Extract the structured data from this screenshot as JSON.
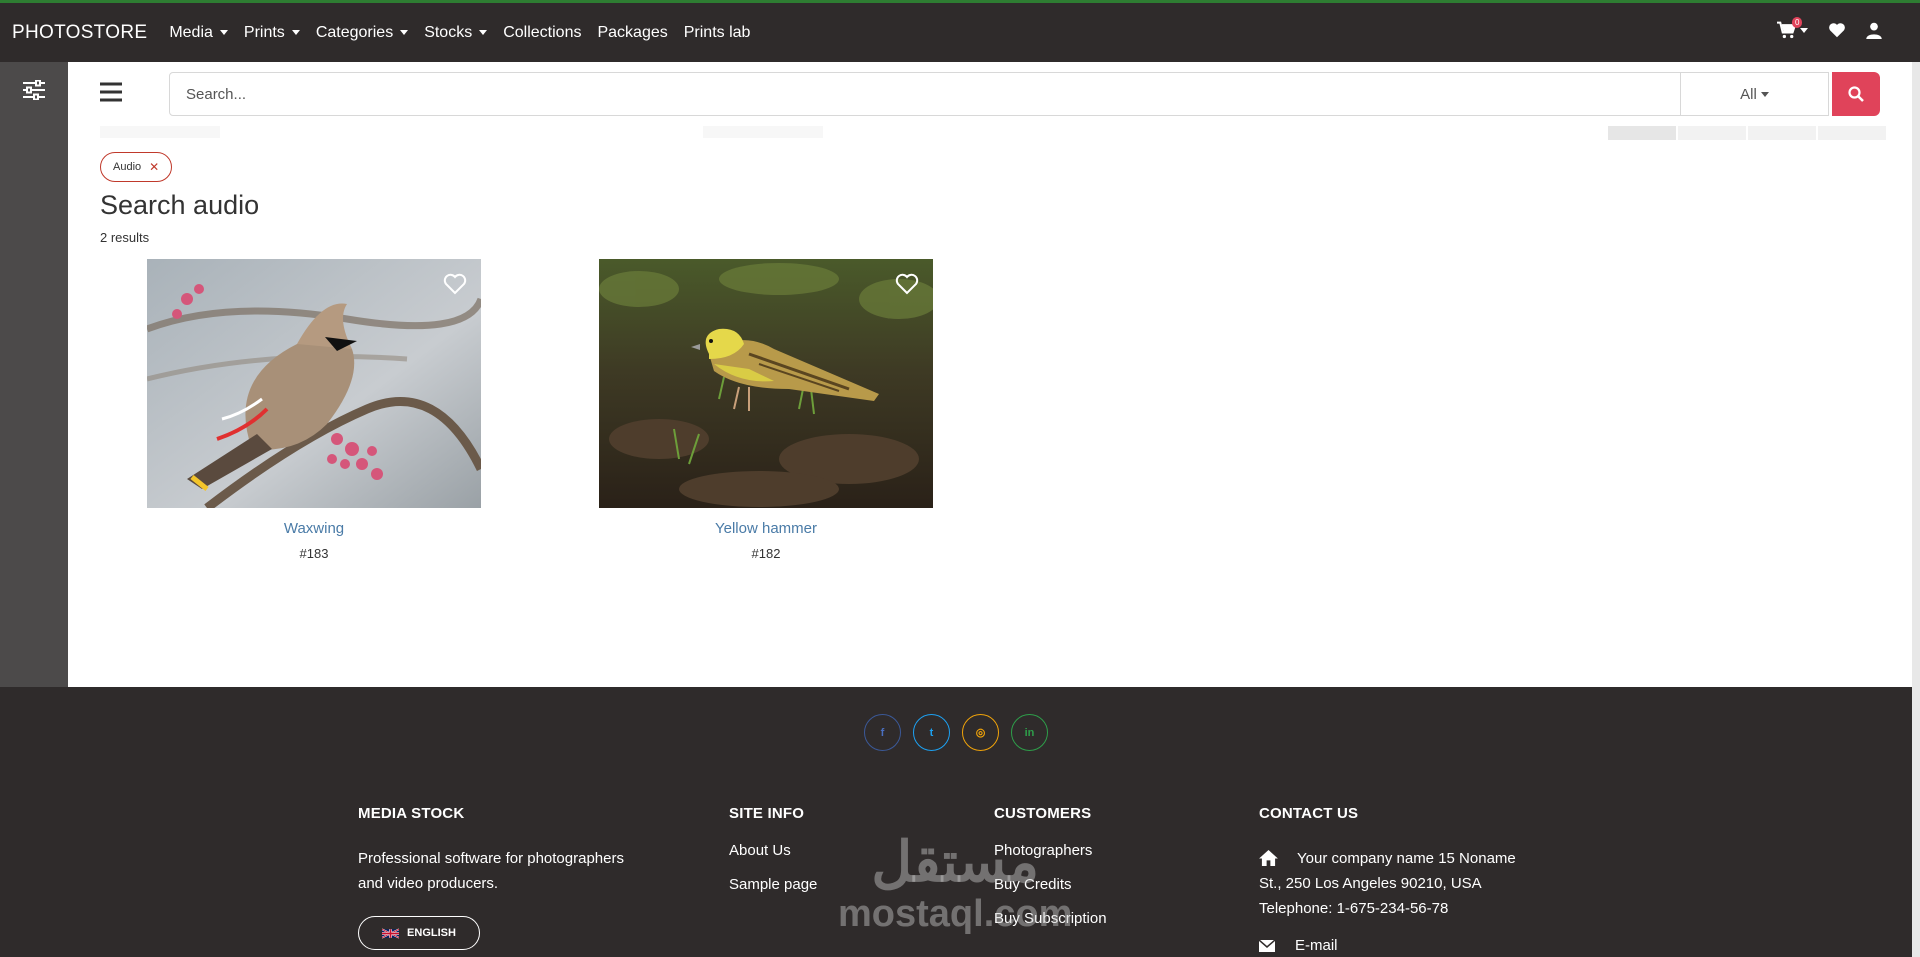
{
  "header": {
    "brand": "PHOTOSTORE",
    "nav": [
      {
        "label": "Media",
        "dropdown": true
      },
      {
        "label": "Prints",
        "dropdown": true
      },
      {
        "label": "Categories",
        "dropdown": true
      },
      {
        "label": "Stocks",
        "dropdown": true
      },
      {
        "label": "Collections",
        "dropdown": false
      },
      {
        "label": "Packages",
        "dropdown": false
      },
      {
        "label": "Prints lab",
        "dropdown": false
      }
    ],
    "cart_count": "0",
    "icons": [
      "cart-icon",
      "heart-icon",
      "user-icon"
    ]
  },
  "search": {
    "placeholder": "Search...",
    "scope": "All"
  },
  "filter_chip": "Audio",
  "page": {
    "title": "Search audio",
    "results": "2 results"
  },
  "items": [
    {
      "title": "Waxwing",
      "id": "#183"
    },
    {
      "title": "Yellow hammer",
      "id": "#182"
    }
  ],
  "footer": {
    "socials": [
      {
        "name": "facebook-icon",
        "glyph": "f",
        "color": "#3b5998"
      },
      {
        "name": "twitter-icon",
        "glyph": "t",
        "color": "#1da1f2"
      },
      {
        "name": "instagram-icon",
        "glyph": "◎",
        "color": "#f0a30a"
      },
      {
        "name": "linkedin-icon",
        "glyph": "in",
        "color": "#2e9e4a"
      }
    ],
    "media_stock": {
      "heading": "MEDIA STOCK",
      "text1": "Professional software for photographers",
      "text2": "and video producers.",
      "language": "ENGLISH"
    },
    "site_info": {
      "heading": "SITE INFO",
      "links": [
        "About Us",
        "Sample page"
      ]
    },
    "customers": {
      "heading": "CUSTOMERS",
      "links": [
        "Photographers",
        "Buy Credits",
        "Buy Subscription"
      ]
    },
    "contact": {
      "heading": "CONTACT US",
      "address1": "Your company name 15 Noname",
      "address2": "St., 250 Los Angeles 90210, USA",
      "telephone": "Telephone: 1-675-234-56-78",
      "email": "E-mail"
    },
    "watermark_top": "مستقل",
    "watermark_bottom": "mostaql.com"
  },
  "colors": {
    "accent": "#e0435a",
    "dark": "#2f2b2b",
    "link": "#4a7ba7"
  }
}
